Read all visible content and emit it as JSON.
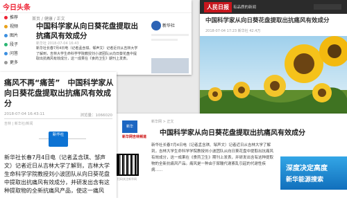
{
  "p1": {
    "logo": "今日头条",
    "sidebar": [
      {
        "label": "推荐",
        "color": "#e23"
      },
      {
        "label": "视频",
        "color": "#e9a21a"
      },
      {
        "label": "图片",
        "color": "#3b8fe0"
      },
      {
        "label": "段子",
        "color": "#2ab673"
      },
      {
        "label": "问答",
        "color": "#3b8fe0"
      },
      {
        "label": "更多",
        "color": "#999"
      }
    ],
    "breadcrumb": "首页 / 健康 / 正文",
    "title": "中国科学家从向日葵花盘提取出抗痛风有效成分",
    "meta": "新华社  2018-07-04 16:43",
    "body": "新华社长春7月4日电（记者孟含琪、邹声文）记者近日从吉林大学了解到，吉林大学生命科学学院教授刘小波团队从向日葵花盘中提取出抗痛风有效成分，这一成果在《食药卫生》期刊上发表。",
    "card_name": "新华社"
  },
  "p2": {
    "logo": "人民日报",
    "tagline": "有品质的新闻",
    "title": "中国科学家从向日葵花盘提取出抗痛风有效成分",
    "meta": "2018-07-04 17:23  新华社  42.4万"
  },
  "p3": {
    "title": "痛风不再“痛苦”　中国科学家从向日葵花盘提取出抗痛风有效成分",
    "time": "2018-07-04 16:43:11",
    "views": "浏览量：1066020",
    "source": "吉林 | 新华社/新闻",
    "xlogo_top": "新华社",
    "body": "新华社长春7月4日电（记者孟含琪、邹声文）记者近日从吉林大学了解到，吉林大学生命科学学院教授刘小波团队从向日葵花盘中提取出抗痛风有效成分，并研发出含有这种提取物的全新抗痛风产品，使这一痛风"
  },
  "p4": {
    "breadcrumb": "新华网 > 正文",
    "sitename": "新华网吉林频道",
    "title": "中国科学家从向日葵花盘提取出抗痛风有效成分",
    "body": "新华社长春7月4日电（记者孟含琪、邹声文）记者近日从吉林大学了解到，吉林大学生命科学学院教授刘小波团队从向日葵花盘中提取出抗痛风有效成分，这一成果在《食药卫生》期刊上发表，并研发出含有这种提取物的全新抗痛风产品。痛风是一种由于尿酸代谢紊乱引起的代谢性疾病……",
    "qr_label": "扫码关注新华网",
    "ad_line1": "深度决定高度",
    "ad_line2": "新华能源搜索"
  }
}
